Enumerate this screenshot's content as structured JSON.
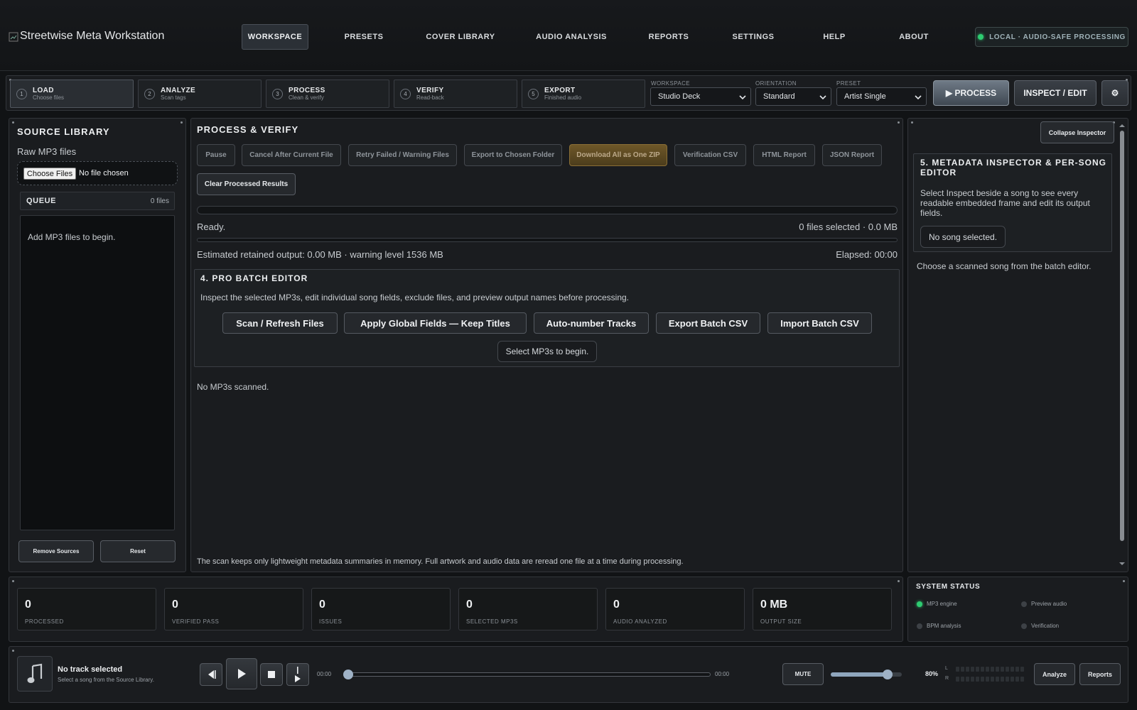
{
  "app": {
    "title": "Streetwise Meta Workstation"
  },
  "nav": {
    "items": [
      {
        "label": "WORKSPACE"
      },
      {
        "label": "PRESETS"
      },
      {
        "label": "COVER LIBRARY"
      },
      {
        "label": "AUDIO ANALYSIS"
      },
      {
        "label": "REPORTS"
      },
      {
        "label": "SETTINGS"
      },
      {
        "label": "HELP"
      },
      {
        "label": "ABOUT"
      }
    ],
    "active": "WORKSPACE",
    "status": "LOCAL · AUDIO-SAFE PROCESSING"
  },
  "steps": [
    {
      "num": "1",
      "title": "LOAD",
      "sub": "Choose files"
    },
    {
      "num": "2",
      "title": "ANALYZE",
      "sub": "Scan tags"
    },
    {
      "num": "3",
      "title": "PROCESS",
      "sub": "Clean & verify"
    },
    {
      "num": "4",
      "title": "VERIFY",
      "sub": "Read-back"
    },
    {
      "num": "5",
      "title": "EXPORT",
      "sub": "Finished audio"
    }
  ],
  "selects": {
    "workspace": {
      "label": "WORKSPACE",
      "value": "Studio Deck"
    },
    "orientation": {
      "label": "ORIENTATION",
      "value": "Standard"
    },
    "preset": {
      "label": "PRESET",
      "value": "Artist Single"
    }
  },
  "toolbar": {
    "process": "▶ PROCESS",
    "inspect": "INSPECT / EDIT",
    "settings_glyph": "⚙"
  },
  "source": {
    "title": "SOURCE LIBRARY",
    "raw_label": "Raw MP3 files",
    "choose_button": "Choose Files",
    "no_file": "No file chosen",
    "queue_title": "QUEUE",
    "queue_count": "0 files",
    "empty_hint": "Add MP3 files to begin.",
    "remove": "Remove Sources",
    "reset": "Reset"
  },
  "process": {
    "title": "PROCESS & VERIFY",
    "actions": [
      "Pause",
      "Cancel After Current File",
      "Retry Failed / Warning Files",
      "Export to Chosen Folder",
      "Download All as One ZIP",
      "Verification CSV",
      "HTML Report",
      "JSON Report"
    ],
    "clear": "Clear Processed Results",
    "status": "Ready.",
    "selection": "0 files selected · 0.0 MB",
    "progress": 0,
    "estimate": "Estimated retained output: 0.00 MB · warning level 1536 MB",
    "elapsed": "Elapsed: 00:00",
    "footnote": "The scan keeps only lightweight metadata summaries in memory. Full artwork and audio data are reread one file at a time during processing."
  },
  "batch": {
    "title": "4. PRO BATCH EDITOR",
    "description": "Inspect the selected MP3s, edit individual song fields, exclude files, and preview output names before processing.",
    "buttons": [
      "Scan / Refresh Files",
      "Apply Global Fields — Keep Titles",
      "Auto-number Tracks",
      "Export Batch CSV",
      "Import Batch CSV"
    ],
    "select_hint": "Select MP3s to begin.",
    "none_scanned": "No MP3s scanned."
  },
  "inspector": {
    "collapse": "Collapse Inspector",
    "title": "5. METADATA INSPECTOR & PER-SONG EDITOR",
    "description": "Select Inspect beside a song to see every readable embedded frame and edit its output fields.",
    "no_song": "No song selected.",
    "hint": "Choose a scanned song from the batch editor."
  },
  "stats": [
    {
      "value": "0",
      "label": "PROCESSED"
    },
    {
      "value": "0",
      "label": "VERIFIED PASS"
    },
    {
      "value": "0",
      "label": "ISSUES"
    },
    {
      "value": "0",
      "label": "SELECTED MP3S"
    },
    {
      "value": "0",
      "label": "AUDIO ANALYZED"
    },
    {
      "value": "0 MB",
      "label": "OUTPUT SIZE"
    }
  ],
  "system": {
    "title": "SYSTEM STATUS",
    "items": [
      {
        "label": "MP3 engine",
        "state": "on"
      },
      {
        "label": "Preview audio",
        "state": "off"
      },
      {
        "label": "BPM analysis",
        "state": "off"
      },
      {
        "label": "Verification",
        "state": "off"
      }
    ]
  },
  "player": {
    "track": "No track selected",
    "sub": "Select a song from the Source Library.",
    "time_start": "00:00",
    "time_end": "00:00",
    "position": 0,
    "mute": "MUTE",
    "volume": 80,
    "volume_label": "80%",
    "ch_left": "L",
    "ch_right": "R",
    "analyze": "Analyze",
    "reports": "Reports"
  },
  "colors": {
    "accent_green": "#2ecc71",
    "zip_gold": "#6e5728"
  }
}
